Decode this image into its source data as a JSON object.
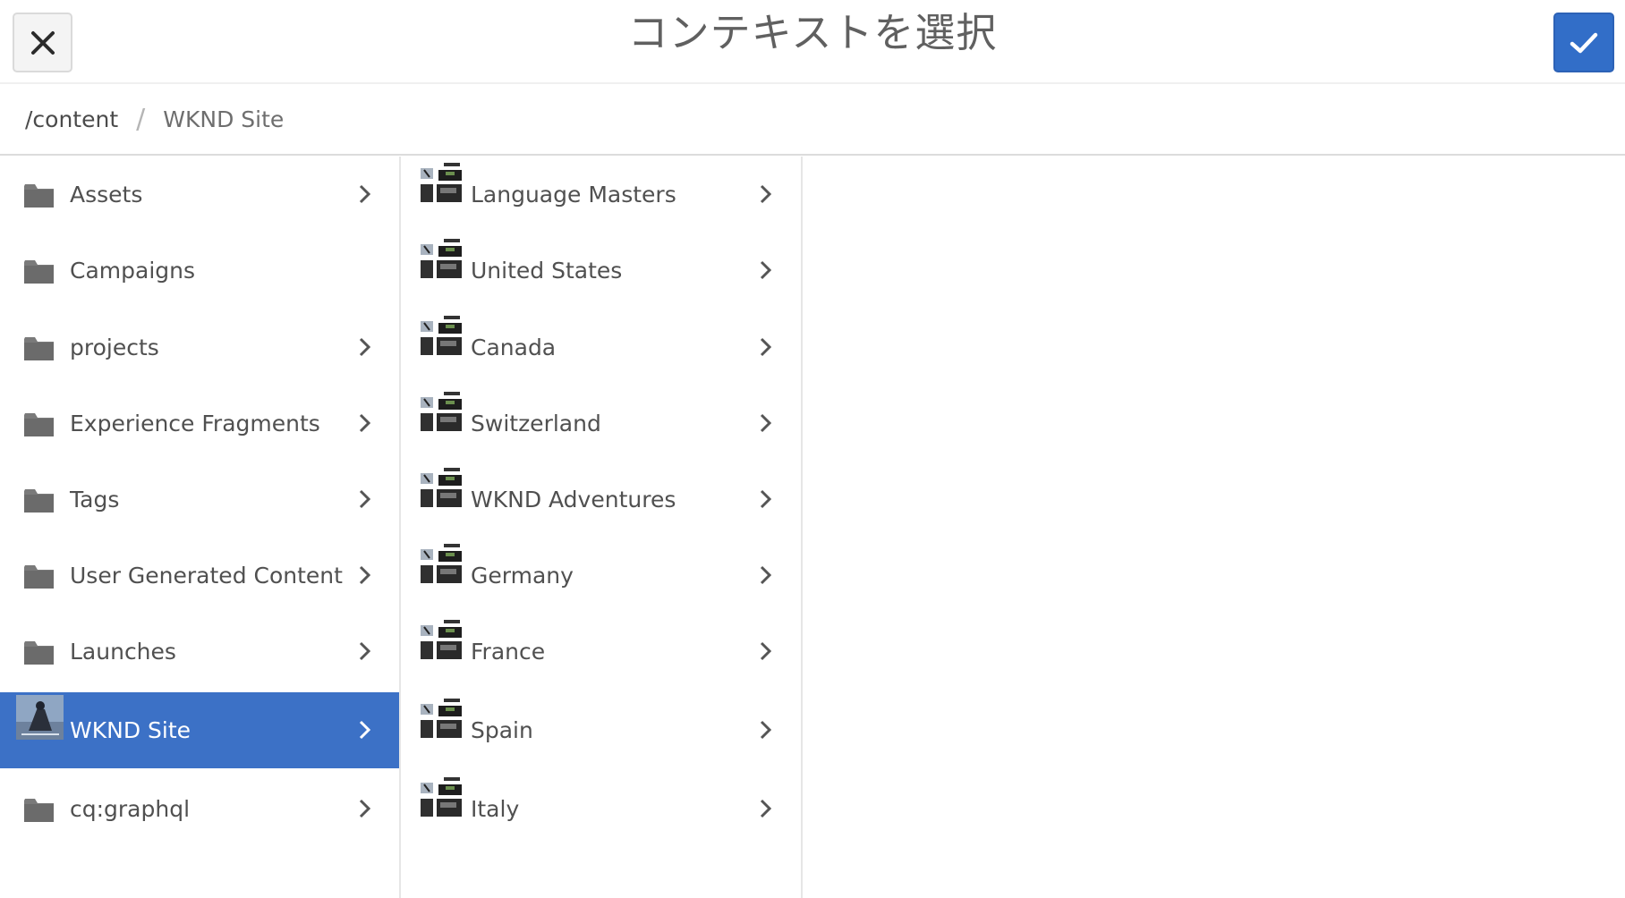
{
  "header": {
    "title": "コンテキストを選択",
    "close_icon": "close-icon",
    "select_icon": "checkmark-icon",
    "accent_color": "#326ec8"
  },
  "breadcrumb": {
    "root": "/content",
    "separator": "/",
    "current": "WKND Site"
  },
  "column1": {
    "items": [
      {
        "label": "Assets",
        "icon": "folder-icon",
        "has_children": true
      },
      {
        "label": "Campaigns",
        "icon": "folder-icon",
        "has_children": false
      },
      {
        "label": "projects",
        "icon": "folder-icon",
        "has_children": true
      },
      {
        "label": "Experience Fragments",
        "icon": "folder-icon",
        "has_children": true
      },
      {
        "label": "Tags",
        "icon": "folder-icon",
        "has_children": true
      },
      {
        "label": "User Generated Content",
        "icon": "folder-icon",
        "has_children": true
      },
      {
        "label": "Launches",
        "icon": "folder-icon",
        "has_children": true
      },
      {
        "label": "WKND Site",
        "icon": "site-thumbnail",
        "has_children": true,
        "selected": true
      },
      {
        "label": "cq:graphql",
        "icon": "folder-icon",
        "has_children": true
      }
    ]
  },
  "column2": {
    "items": [
      {
        "label": "Language Masters",
        "icon": "page-thumbnail",
        "has_children": true
      },
      {
        "label": "United States",
        "icon": "page-thumbnail",
        "has_children": true
      },
      {
        "label": "Canada",
        "icon": "page-thumbnail",
        "has_children": true
      },
      {
        "label": "Switzerland",
        "icon": "page-thumbnail",
        "has_children": true
      },
      {
        "label": "WKND Adventures",
        "icon": "page-thumbnail",
        "has_children": true
      },
      {
        "label": "Germany",
        "icon": "page-thumbnail",
        "has_children": true
      },
      {
        "label": "France",
        "icon": "page-thumbnail",
        "has_children": true
      },
      {
        "label": "Spain",
        "icon": "page-thumbnail",
        "has_children": true
      },
      {
        "label": "Italy",
        "icon": "page-thumbnail",
        "has_children": true
      }
    ]
  }
}
